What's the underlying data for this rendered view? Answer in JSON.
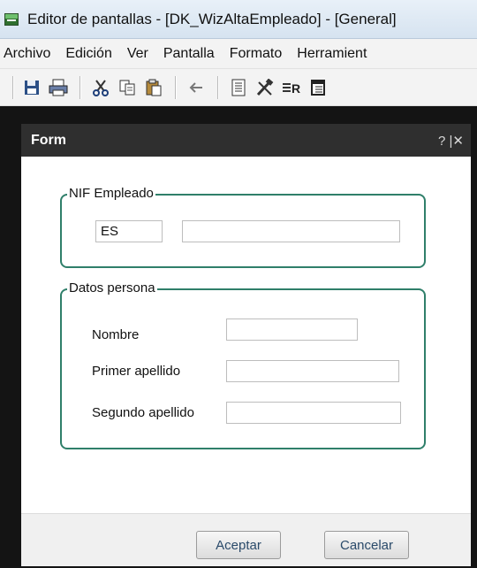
{
  "window": {
    "title": "Editor de pantallas - [DK_WizAltaEmpleado] - [General]"
  },
  "menu": [
    "Archivo",
    "Edición",
    "Ver",
    "Pantalla",
    "Formato",
    "Herramient"
  ],
  "toolbar_icons": [
    "save-icon",
    "print-icon",
    "cut-icon",
    "copy-icon",
    "paste-icon",
    "back-arrow-icon",
    "properties-icon",
    "tools-icon",
    "tab-order-icon",
    "columns-icon"
  ],
  "form": {
    "title": "Form",
    "help_close": "? |✕",
    "nif_group": {
      "label": "NIF Empleado",
      "country_value": "ES",
      "number_value": ""
    },
    "persona_group": {
      "label": "Datos persona",
      "fields": [
        {
          "label": "Nombre",
          "value": ""
        },
        {
          "label": "Primer apellido",
          "value": ""
        },
        {
          "label": "Segundo apellido",
          "value": ""
        }
      ]
    },
    "buttons": {
      "accept": "Aceptar",
      "cancel": "Cancelar"
    }
  },
  "colors": {
    "group_border": "#2f7f6a",
    "form_header": "#2f2f2f",
    "background": "#141414"
  }
}
